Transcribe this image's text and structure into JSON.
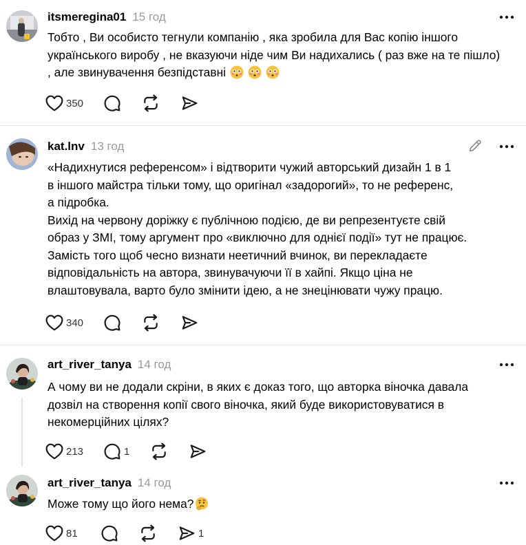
{
  "comments": [
    {
      "username": "itsmeregina01",
      "time": "15 год",
      "text": "Тобто , Ви особисто тегнули компанію , яка зробила для Вас копію іншого українського виробу , не вказуючи ніде чим Ви надихались ( раз вже на те пішло) , але звинувачення безпідставні",
      "emojis": [
        "flushed-face",
        "flushed-face",
        "flushed-face"
      ],
      "likes": "350",
      "replies": "",
      "shares": ""
    },
    {
      "username": "kat.lnv",
      "time": "13 год",
      "text": "«Надихнутися референсом» і відтворити чужий авторський дизайн 1 в 1\nв іншого майстра тільки тому, що оригінал «задорогий», то не референс,\nа підробка.\nВихід на червону доріжку є публічною подією, де ви репрезентуєте свій\nобраз у ЗМІ, тому аргумент про «виключно для однієї події» тут не працює.\nЗамість того щоб чесно визнати неетичний вчинок, ви перекладаєте\nвідповідальність на автора, звинувачуючи її в хайпі. Якщо ціна не\nвлаштовувала, варто було змінити ідею, а не знецінювати чужу працю.",
      "likes": "340",
      "replies": "",
      "shares": ""
    },
    {
      "username": "art_river_tanya",
      "time": "14 год",
      "text": "А чому ви не додали скріни, в яких є доказ того, що авторка віночка давала дозвіл на створення копії свого віночка, який буде використовуватися в некомерційних цілях?",
      "likes": "213",
      "replies": "1",
      "shares": ""
    },
    {
      "username": "art_river_tanya",
      "time": "14 год",
      "text": "Може тому що його нема?",
      "emojis": [
        "thinking-face"
      ],
      "likes": "81",
      "replies": "",
      "shares": "1"
    }
  ],
  "icons": {
    "like": "heart-icon",
    "reply": "comment-icon",
    "repost": "repost-icon",
    "share": "send-icon",
    "more": "more-options-icon",
    "edit": "pencil-icon"
  },
  "colors": {
    "text": "#000000",
    "muted": "#999999",
    "icon": "#1a1a1a",
    "divider": "#e3e3e3",
    "emoji": "#f7c43d"
  }
}
